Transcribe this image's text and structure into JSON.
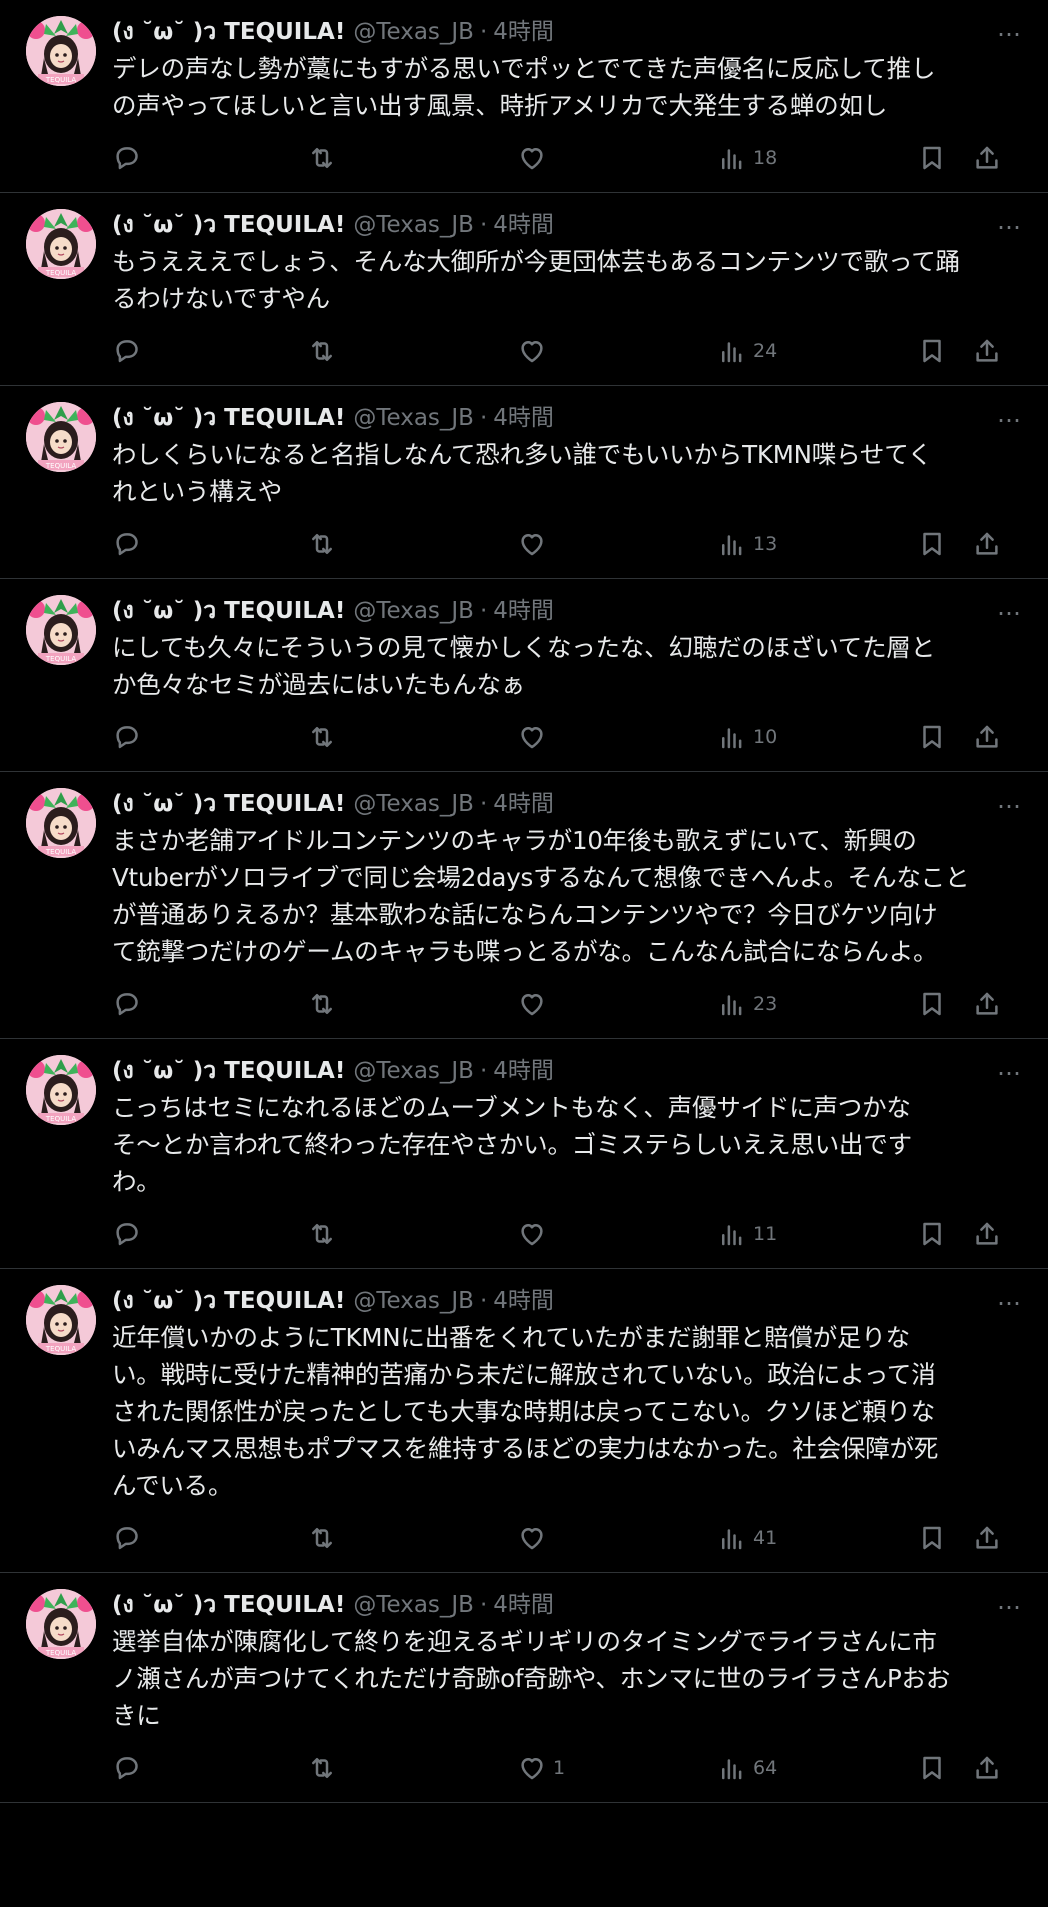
{
  "author": {
    "name": "(ง ˘ω˘ )ว TEQUILA!",
    "handle": "@Texas_JB",
    "separator": "·",
    "avatar_icon": "anime-character-avatar"
  },
  "colors": {
    "background": "#000000",
    "text": "#e7e9ea",
    "secondary": "#71767b",
    "divider": "#2f3336"
  },
  "tweets": [
    {
      "time": "4時間",
      "text": "デレの声なし勢が藁にもすがる思いでポッとでてきた声優名に反応して推し\nの声やってほしいと言い出す風景、時折アメリカで大発生する蝉の如し",
      "likes": "",
      "views": "18"
    },
    {
      "time": "4時間",
      "text": "もうえええでしょう、そんな大御所が今更団体芸もあるコンテンツで歌って踊\nるわけないですやん",
      "likes": "",
      "views": "24"
    },
    {
      "time": "4時間",
      "text": "わしくらいになると名指しなんて恐れ多い誰でもいいからTKMN喋らせてく\nれという構えや",
      "likes": "",
      "views": "13"
    },
    {
      "time": "4時間",
      "text": "にしても久々にそういうの見て懐かしくなったな、幻聴だのほざいてた層と\nか色々なセミが過去にはいたもんなぁ",
      "likes": "",
      "views": "10"
    },
    {
      "time": "4時間",
      "text": "まさか老舗アイドルコンテンツのキャラが10年後も歌えずにいて、新興の\nVtuberがソロライブで同じ会場2daysするなんて想像できへんよ。そんなこと\nが普通ありえるか？基本歌わな話にならんコンテンツやで？今日びケツ向け\nて銃撃つだけのゲームのキャラも喋っとるがな。こんなん試合にならんよ。",
      "likes": "",
      "views": "23"
    },
    {
      "time": "4時間",
      "text": "こっちはセミになれるほどのムーブメントもなく、声優サイドに声つかな\nそ～とか言われて終わった存在やさかい。ゴミステらしいええ思い出です\nわ。",
      "likes": "",
      "views": "11"
    },
    {
      "time": "4時間",
      "text": "近年償いかのようにTKMNに出番をくれていたがまだ謝罪と賠償が足りな\nい。戦時に受けた精神的苦痛から未だに解放されていない。政治によって消\nされた関係性が戻ったとしても大事な時期は戻ってこない。クソほど頼りな\nいみんマス思想もポプマスを維持するほどの実力はなかった。社会保障が死\nんでいる。",
      "likes": "",
      "views": "41"
    },
    {
      "time": "4時間",
      "text": "選挙自体が陳腐化して終りを迎えるギリギリのタイミングでライラさんに市\nノ瀬さんが声つけてくれただけ奇跡of奇跡や、ホンマに世のライラさんPおお\nきに",
      "likes": "1",
      "views": "64"
    }
  ],
  "icons": {
    "more": "…",
    "reply": "reply-icon",
    "retweet": "retweet-icon",
    "like": "heart-icon",
    "views": "views-icon",
    "bookmark": "bookmark-icon",
    "share": "share-icon"
  }
}
